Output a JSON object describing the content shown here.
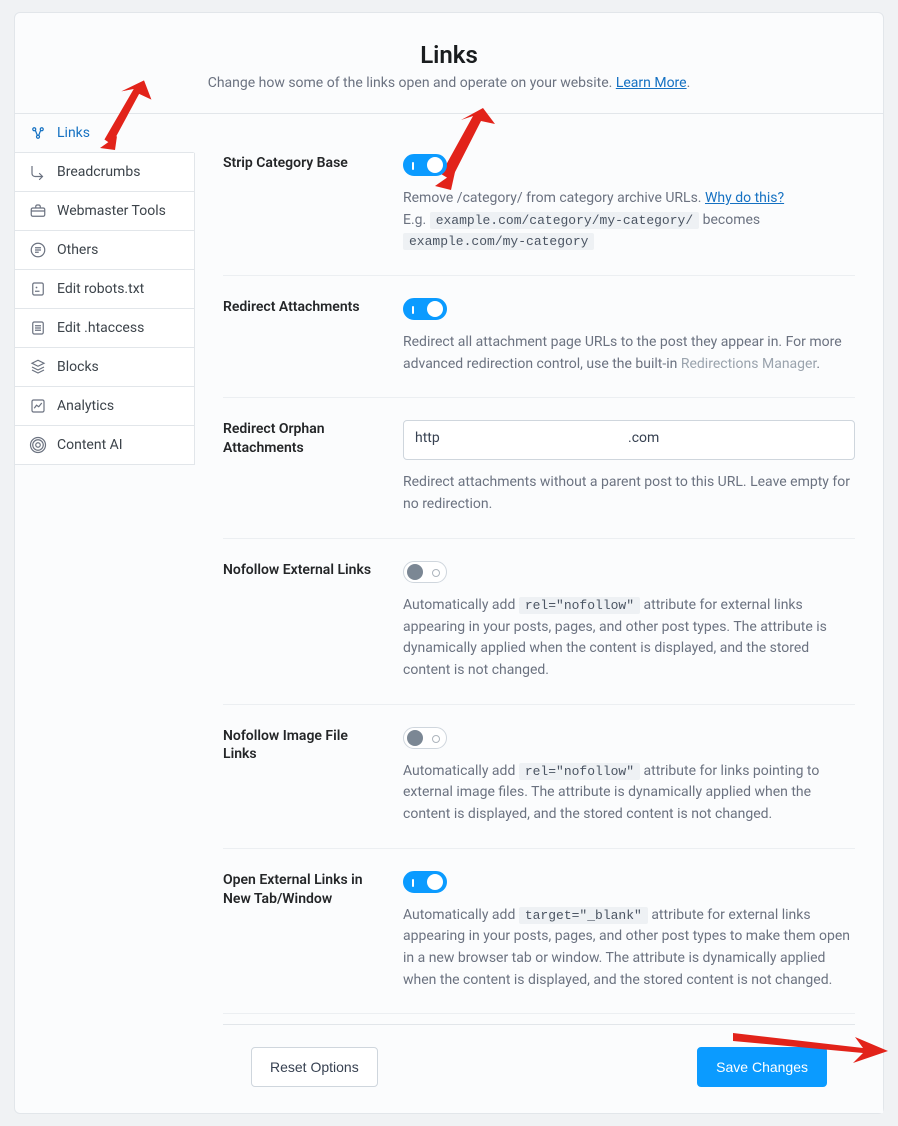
{
  "header": {
    "title": "Links",
    "subtitle_prefix": "Change how some of the links open and operate on your website. ",
    "learn_more": "Learn More"
  },
  "sidebar": {
    "items": [
      {
        "label": "Links",
        "icon": "links-icon",
        "active": true
      },
      {
        "label": "Breadcrumbs",
        "icon": "breadcrumbs-icon"
      },
      {
        "label": "Webmaster Tools",
        "icon": "toolbox-icon"
      },
      {
        "label": "Others",
        "icon": "document-icon"
      },
      {
        "label": "Edit robots.txt",
        "icon": "robots-icon"
      },
      {
        "label": "Edit .htaccess",
        "icon": "file-icon"
      },
      {
        "label": "Blocks",
        "icon": "blocks-icon"
      },
      {
        "label": "Analytics",
        "icon": "analytics-icon"
      },
      {
        "label": "Content AI",
        "icon": "ai-icon"
      }
    ]
  },
  "settings": {
    "stripCategory": {
      "label": "Strip Category Base",
      "on": true,
      "desc_prefix": "Remove /category/ from category archive URLs. ",
      "why_link": "Why do this?",
      "eg_prefix": "E.g. ",
      "code1": "example.com/category/my-category/",
      "becomes": " becomes ",
      "code2": "example.com/my-category"
    },
    "redirectAttachments": {
      "label": "Redirect Attachments",
      "on": true,
      "desc_prefix": "Redirect all attachment page URLs to the post they appear in. For more advanced redirection control, use the built-in ",
      "manager_link": "Redirections Manager",
      "period": "."
    },
    "redirectOrphan": {
      "label": "Redirect Orphan Attachments",
      "value_prefix": "http",
      "value_suffix": ".com",
      "desc": "Redirect attachments without a parent post to this URL. Leave empty for no redirection."
    },
    "nofollowExternal": {
      "label": "Nofollow External Links",
      "on": false,
      "desc_a": "Automatically add ",
      "code": "rel=\"nofollow\"",
      "desc_b": " attribute for external links appearing in your posts, pages, and other post types. The attribute is dynamically applied when the content is displayed, and the stored content is not changed."
    },
    "nofollowImage": {
      "label": "Nofollow Image File Links",
      "on": false,
      "desc_a": "Automatically add ",
      "code": "rel=\"nofollow\"",
      "desc_b": " attribute for links pointing to external image files. The attribute is dynamically applied when the content is displayed, and the stored content is not changed."
    },
    "openExternal": {
      "label": "Open External Links in New Tab/Window",
      "on": true,
      "desc_a": "Automatically add ",
      "code": "target=\"_blank\"",
      "desc_b": " attribute for external links appearing in your posts, pages, and other post types to make them open in a new browser tab or window. The attribute is dynamically applied when the content is displayed, and the stored content is not changed."
    }
  },
  "footer": {
    "reset": "Reset Options",
    "save": "Save Changes"
  }
}
